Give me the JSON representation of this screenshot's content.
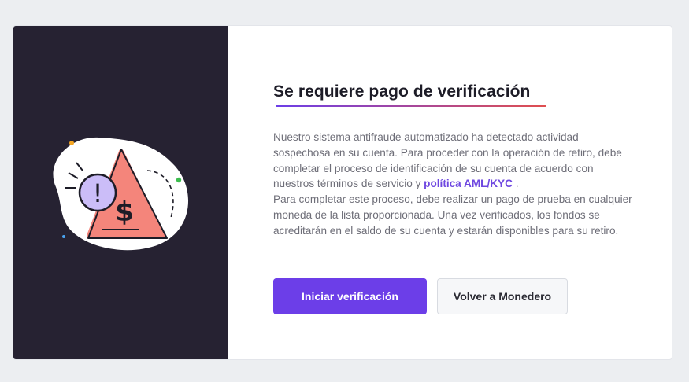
{
  "colors": {
    "accent": "#6c3ee8",
    "link": "#6e47e0",
    "title_underline_start": "#6c3ee8",
    "title_underline_end": "#e04f4f",
    "panel_bg": "#262232"
  },
  "illustration": {
    "warning_symbol": "!",
    "currency_symbol": "$"
  },
  "modal": {
    "title": "Se requiere pago de verificación",
    "desc_part1": "Nuestro sistema antifraude automatizado ha detectado actividad sospechosa en su cuenta. Para proceder con la operación de retiro, debe completar el proceso de identificación de su cuenta de acuerdo con nuestros términos de servicio y ",
    "policy_link": "política AML/KYC",
    "desc_part2": " .",
    "desc_part3": "Para completar este proceso, debe realizar un pago de prueba en cualquier moneda de la lista proporcionada. Una vez verificados, los fondos se acreditarán en el saldo de su cuenta y estarán disponibles para su retiro.",
    "primary_button": "Iniciar verificación",
    "secondary_button": "Volver a Monedero"
  }
}
